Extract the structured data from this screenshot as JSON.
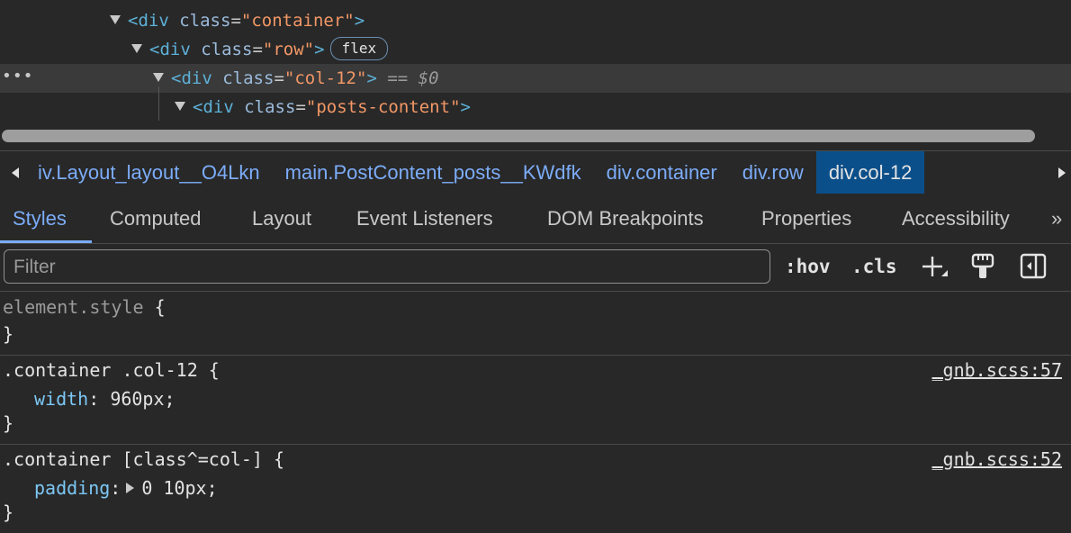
{
  "tree": {
    "rows": [
      {
        "tag": "div",
        "attr": "class",
        "value": "container"
      },
      {
        "tag": "div",
        "attr": "class",
        "value": "row",
        "badge": "flex"
      },
      {
        "tag": "div",
        "attr": "class",
        "value": "col-12",
        "marker": "== $0",
        "dots": "•••"
      },
      {
        "tag": "div",
        "attr": "class",
        "value": "posts-content"
      }
    ]
  },
  "breadcrumb": {
    "items": [
      {
        "tag": "iv",
        "rest": ".Layout_layout__O4Lkn"
      },
      {
        "tag": "main",
        "rest": ".PostContent_posts__KWdfk"
      },
      {
        "tag": "div",
        "rest": ".container"
      },
      {
        "tag": "div",
        "rest": ".row"
      },
      {
        "tag": "div",
        "rest": ".col-12"
      }
    ]
  },
  "tabs": [
    "Styles",
    "Computed",
    "Layout",
    "Event Listeners",
    "DOM Breakpoints",
    "Properties",
    "Accessibility"
  ],
  "tabs_more": "»",
  "filter": {
    "placeholder": "Filter",
    "hov": ":hov",
    "cls": ".cls"
  },
  "rules": [
    {
      "selector": "element.style",
      "open": " {",
      "close": "}"
    },
    {
      "selector": ".container .col-12",
      "open": " {",
      "close": "}",
      "source": "_gnb.scss:57",
      "prop": "width",
      "value": "960px;"
    },
    {
      "selector": ".container [class^=col-]",
      "open": " {",
      "close": "}",
      "source": "_gnb.scss:52",
      "prop": "padding",
      "value": "0 10px;"
    }
  ],
  "colors": {
    "background": "#282828",
    "accent": "#7cacf8",
    "selected_crumb": "#0b4f8a"
  }
}
